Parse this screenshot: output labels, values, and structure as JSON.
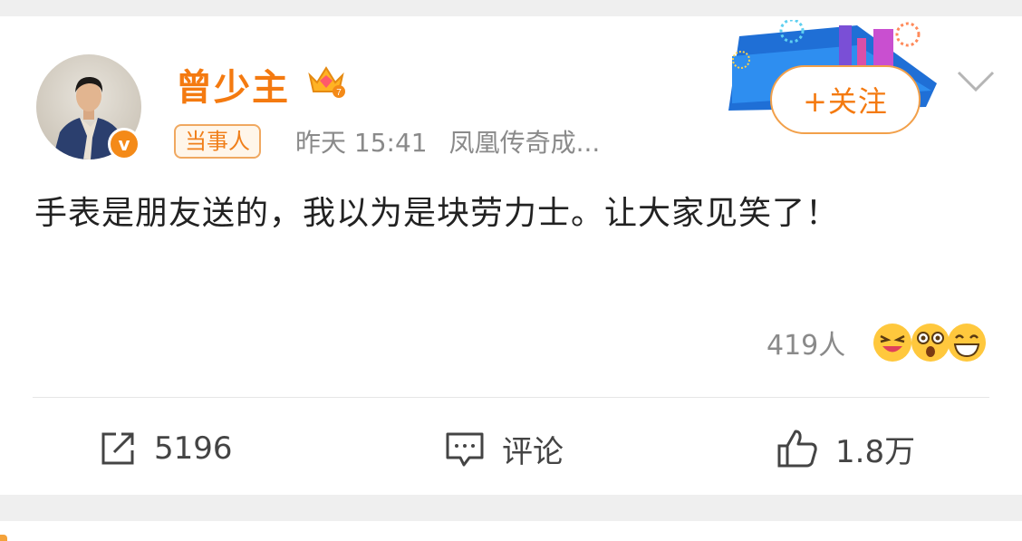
{
  "post": {
    "username": "曾少主",
    "tag": "当事人",
    "time": "昨天 15:41",
    "source": "凤凰传奇成...",
    "follow_label": "+关注",
    "content": "手表是朋友送的，我以为是块劳力士。让大家见笑了！",
    "reaction_count": "419人"
  },
  "actions": {
    "repost_count": "5196",
    "comment_label": "评论",
    "like_count": "1.8万"
  },
  "colors": {
    "brand_orange": "#f47a10",
    "meta_gray": "#8a8a8a",
    "text": "#222222"
  },
  "icons": [
    "verified-icon",
    "crown-level-icon",
    "chevron-down-icon",
    "repost-icon",
    "comment-icon",
    "like-icon"
  ]
}
